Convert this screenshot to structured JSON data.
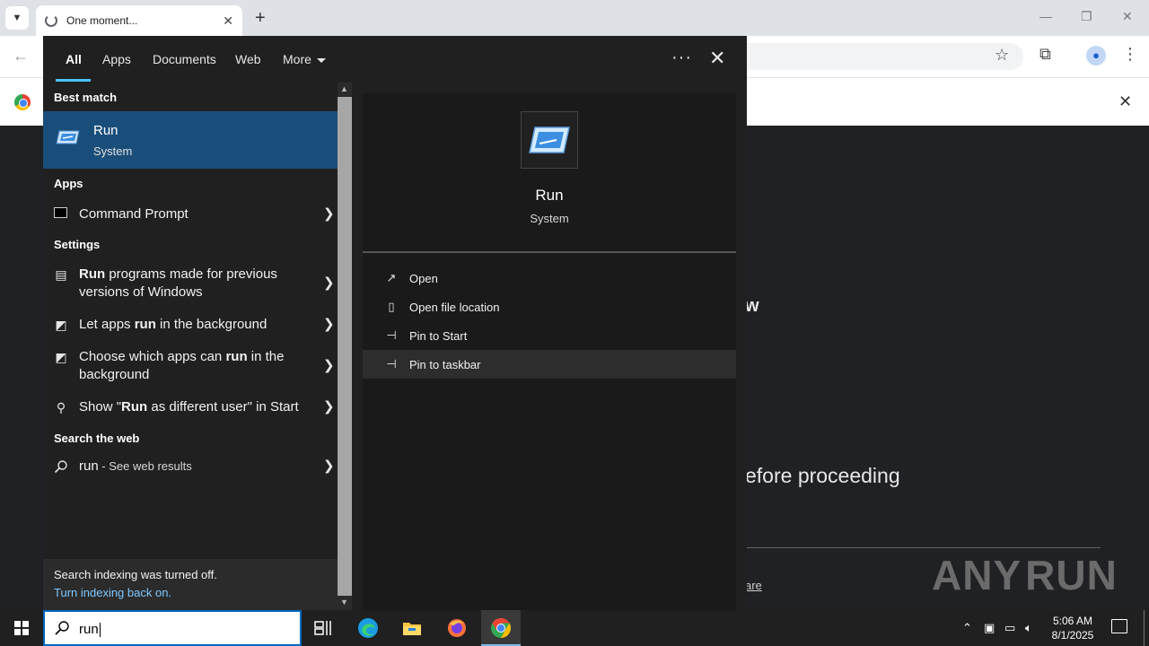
{
  "browser": {
    "tab_title": "One moment...",
    "new_tab": "+",
    "page_fragment_w": "w",
    "page_fragment_proceed": "efore proceeding",
    "page_fragment_link": "are",
    "watermark": "ANY RUN"
  },
  "search": {
    "filters": [
      "All",
      "Apps",
      "Documents",
      "Web",
      "More"
    ],
    "active_filter": "All",
    "best_match_header": "Best match",
    "best_match": {
      "title": "Run",
      "subtitle": "System"
    },
    "apps_header": "Apps",
    "apps": [
      {
        "label": "Command Prompt"
      }
    ],
    "settings_header": "Settings",
    "settings": [
      {
        "bold": "Run",
        "rest": " programs made for previous versions of Windows"
      },
      {
        "pre": "Let apps ",
        "bold": "run",
        "rest": " in the background"
      },
      {
        "pre": "Choose which apps can ",
        "bold": "run",
        "rest": " in the background"
      },
      {
        "pre": "Show \"",
        "bold": "Run",
        "rest": " as different user\" in Start"
      }
    ],
    "web_header": "Search the web",
    "web": {
      "query": "run",
      "suffix": " - See web results"
    },
    "index_notice": "Search indexing was turned off.",
    "index_link": "Turn indexing back on.",
    "preview": {
      "title": "Run",
      "subtitle": "System",
      "actions": [
        "Open",
        "Open file location",
        "Pin to Start",
        "Pin to taskbar"
      ]
    }
  },
  "taskbar": {
    "search_query": "run",
    "time": "5:06 AM",
    "date": "8/1/2025"
  },
  "colors": {
    "accent": "#0067c0",
    "selection": "#1a4e7a",
    "link": "#7fc8ff"
  }
}
